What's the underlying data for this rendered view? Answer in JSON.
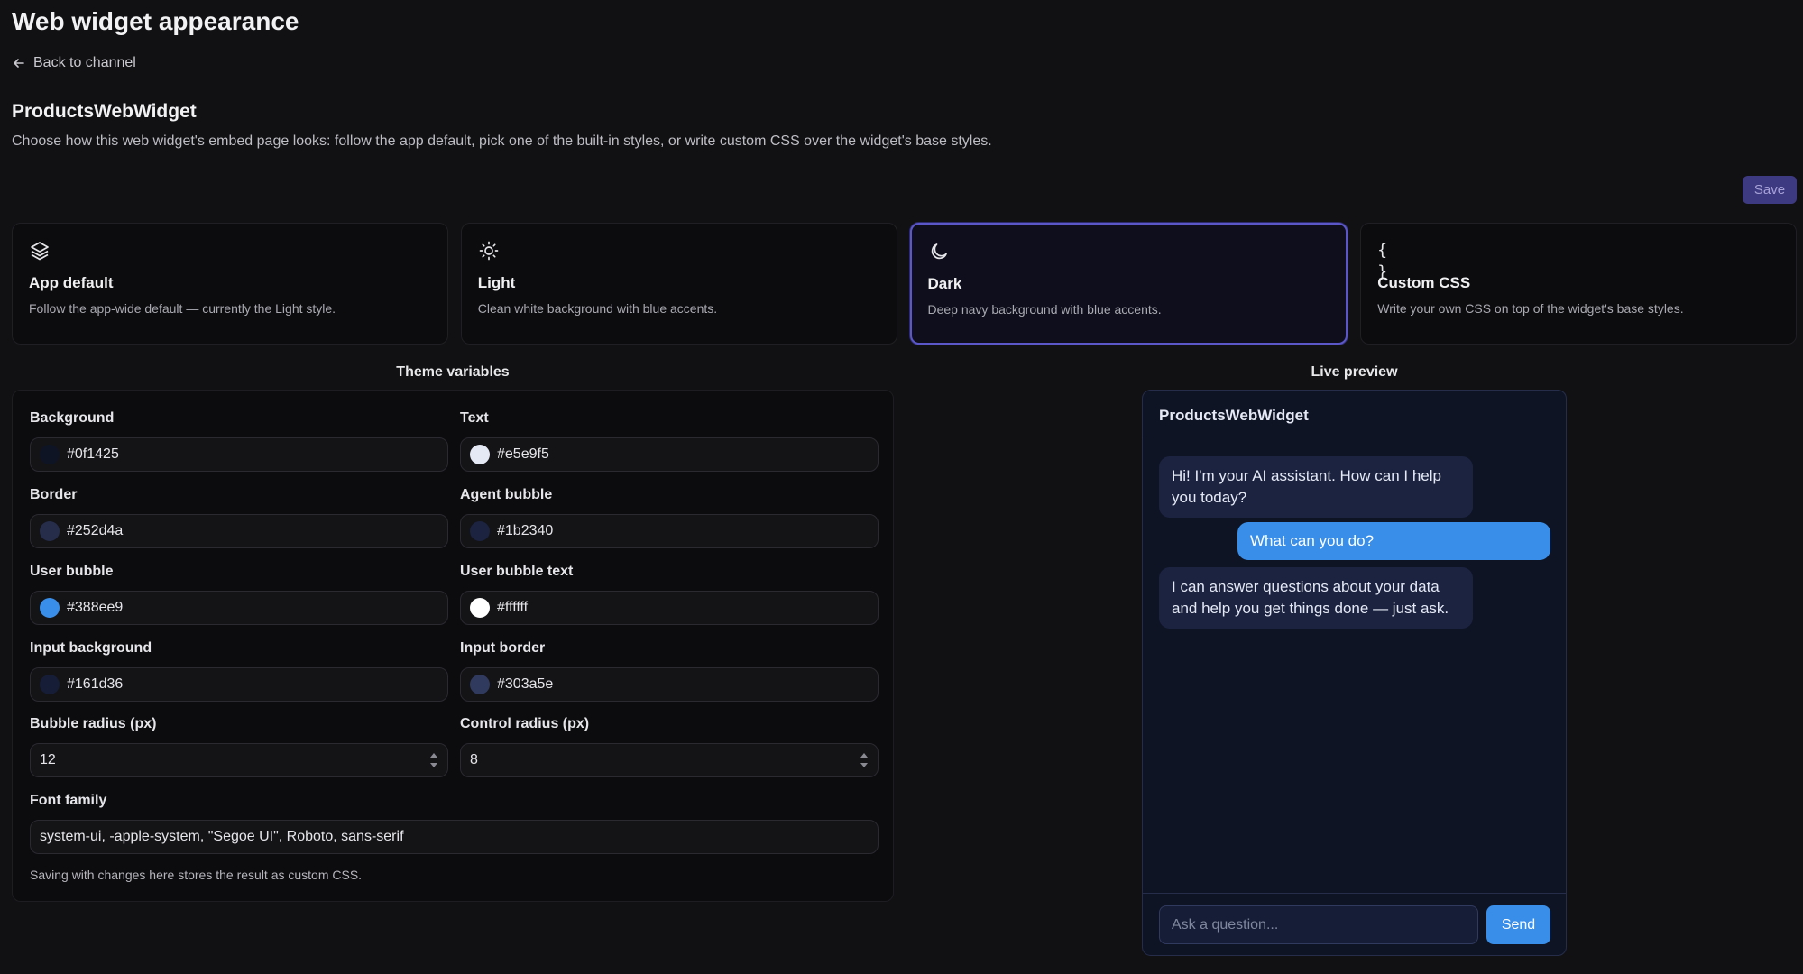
{
  "header": {
    "title": "Web widget appearance",
    "back_label": "Back to channel",
    "widget_name": "ProductsWebWidget",
    "description": "Choose how this web widget's embed page looks: follow the app default, pick one of the built-in styles, or write custom CSS over the widget's base styles.",
    "save_label": "Save"
  },
  "style_options": [
    {
      "title": "App default",
      "desc": "Follow the app-wide default — currently the Light style.",
      "icon": "layers-icon",
      "selected": false
    },
    {
      "title": "Light",
      "desc": "Clean white background with blue accents.",
      "icon": "sun-icon",
      "selected": false
    },
    {
      "title": "Dark",
      "desc": "Deep navy background with blue accents.",
      "icon": "moon-icon",
      "selected": true
    },
    {
      "title": "Custom CSS",
      "desc": "Write your own CSS on top of the widget's base styles.",
      "icon": "braces-icon",
      "selected": false
    }
  ],
  "theme": {
    "heading": "Theme variables",
    "fields": {
      "background": {
        "label": "Background",
        "value": "#0f1425",
        "color": "#0f1425"
      },
      "text": {
        "label": "Text",
        "value": "#e5e9f5",
        "color": "#e5e9f5"
      },
      "border": {
        "label": "Border",
        "value": "#252d4a",
        "color": "#252d4a"
      },
      "agent_bubble": {
        "label": "Agent bubble",
        "value": "#1b2340",
        "color": "#1b2340"
      },
      "user_bubble": {
        "label": "User bubble",
        "value": "#388ee9",
        "color": "#388ee9"
      },
      "user_bubble_text": {
        "label": "User bubble text",
        "value": "#ffffff",
        "color": "#ffffff"
      },
      "input_background": {
        "label": "Input background",
        "value": "#161d36",
        "color": "#161d36"
      },
      "input_border": {
        "label": "Input border",
        "value": "#303a5e",
        "color": "#303a5e"
      },
      "bubble_radius": {
        "label": "Bubble radius (px)",
        "value": "12"
      },
      "control_radius": {
        "label": "Control radius (px)",
        "value": "8"
      },
      "font_family": {
        "label": "Font family",
        "value": "system-ui, -apple-system, \"Segoe UI\", Roboto, sans-serif"
      }
    },
    "note": "Saving with changes here stores the result as custom CSS."
  },
  "preview": {
    "heading": "Live preview",
    "title": "ProductsWebWidget",
    "messages": [
      {
        "role": "agent",
        "text": "Hi! I'm your AI assistant. How can I help you today?"
      },
      {
        "role": "user",
        "text": "What can you do?"
      },
      {
        "role": "agent",
        "text": "I can answer questions about your data and help you get things done — just ask."
      }
    ],
    "input_placeholder": "Ask a question...",
    "send_label": "Send"
  },
  "colors": {
    "page_bg": "#111113",
    "accent": "#5b57c9",
    "save_bg": "#3e3a82"
  }
}
